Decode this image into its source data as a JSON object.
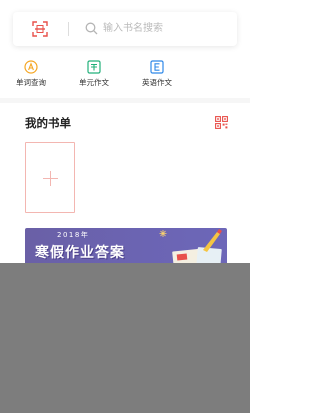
{
  "search": {
    "placeholder": "输入书名搜索"
  },
  "quick_links": [
    {
      "label": "单词查询",
      "icon": "word-lookup-icon",
      "color": "#f5a623"
    },
    {
      "label": "单元作文",
      "icon": "unit-essay-icon",
      "color": "#21b07a"
    },
    {
      "label": "英语作文",
      "icon": "english-essay-icon",
      "color": "#2f88e8"
    }
  ],
  "booklist": {
    "title": "我的书单"
  },
  "banner": {
    "year": "2018年",
    "title": "寒假作业答案"
  },
  "colors": {
    "accent": "#e8504a",
    "banner_bg": "#6b64b3",
    "overlay": "#7d7d7d"
  }
}
